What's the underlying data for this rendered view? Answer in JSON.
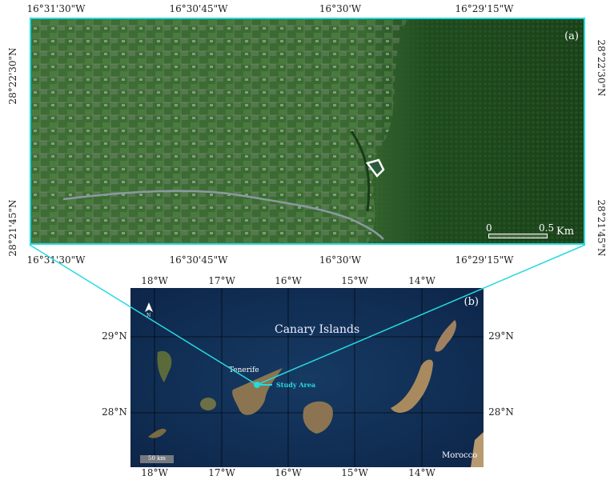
{
  "panel_a": {
    "label": "(a)",
    "top_ticks": [
      "16°31'30\"W",
      "16°30'45\"W",
      "16°30'W",
      "16°29'15\"W"
    ],
    "bottom_ticks": [
      "16°31'30\"W",
      "16°30'45\"W",
      "16°30'W",
      "16°29'15\"W"
    ],
    "left_ticks": [
      "28°22'30\"N",
      "28°21'45\"N"
    ],
    "right_ticks": [
      "28°22'30\"N",
      "28°21'45\"N"
    ],
    "scale_bar": {
      "start": "0",
      "end": "0.5",
      "unit": "Km"
    }
  },
  "panel_b": {
    "label": "(b)",
    "title": "Canary Islands",
    "top_ticks": [
      "18°W",
      "17°W",
      "16°W",
      "15°W",
      "14°W"
    ],
    "bottom_ticks": [
      "18°W",
      "17°W",
      "16°W",
      "15°W",
      "14°W"
    ],
    "left_ticks": [
      "29°N",
      "28°N"
    ],
    "right_ticks": [
      "29°N",
      "28°N"
    ],
    "island_label": "Tenerife",
    "study_area_label": "Study Area",
    "country_label": "Morocco",
    "scale_bar": "50 km",
    "north_arrow": "N"
  },
  "colors": {
    "highlight": "#27d9e0",
    "ocean": "#0f2a4e",
    "vegetation": "#2f6a2a"
  }
}
